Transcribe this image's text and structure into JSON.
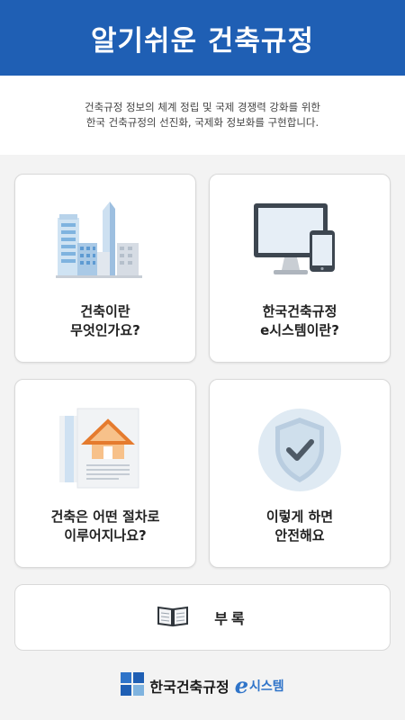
{
  "header": {
    "title": "알기쉬운 건축규정"
  },
  "intro": {
    "line1": "건축규정 정보의 체계 정립 및 국제 경쟁력 강화를 위한",
    "line2": "한국 건축규정의 선진화, 국제화 정보화를 구현합니다."
  },
  "cards": [
    {
      "icon": "city-buildings-icon",
      "line1": "건축이란",
      "line2": "무엇인가요?"
    },
    {
      "icon": "computer-phone-icon",
      "line1": "한국건축규정",
      "line2": "e시스템이란?"
    },
    {
      "icon": "house-document-icon",
      "line1": "건축은 어떤 절차로",
      "line2": "이루어지나요?"
    },
    {
      "icon": "security-shield-icon",
      "line1": "이렇게 하면",
      "line2": "안전해요"
    }
  ],
  "appendix": {
    "icon": "open-book-icon",
    "label": "부록"
  },
  "footer": {
    "brand": "한국건축규정",
    "e": "e",
    "sys": "시스템"
  },
  "colors": {
    "primary": "#1f5fb4",
    "accent": "#2f74c9"
  }
}
